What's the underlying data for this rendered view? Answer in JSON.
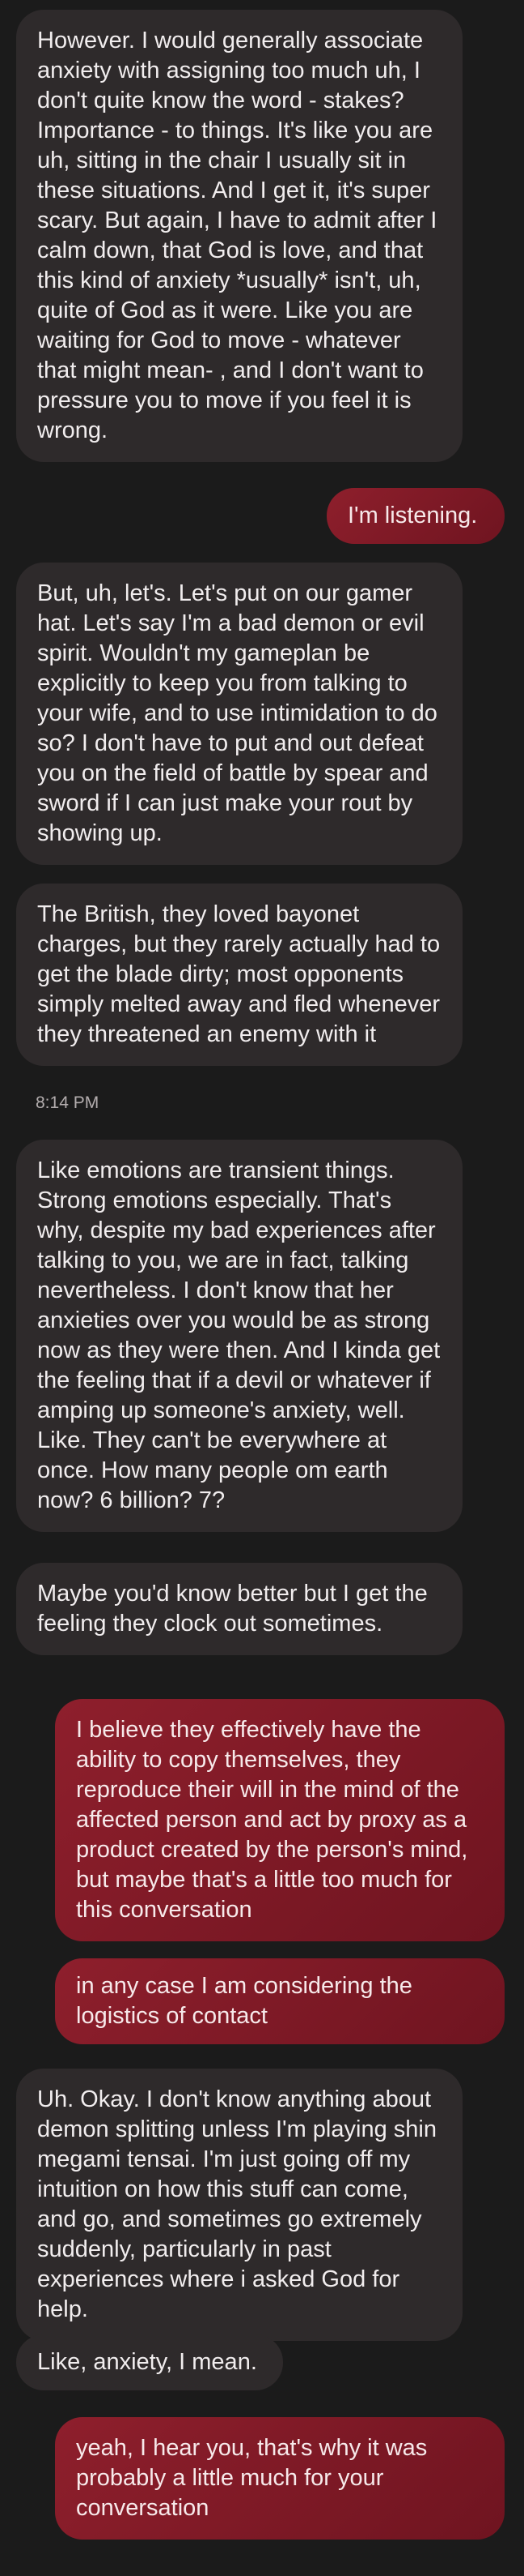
{
  "messages": [
    {
      "direction": "incoming",
      "text": "However. I would generally associate anxiety with assigning too much uh, I don't quite know the word - stakes? Importance - to things. It's like you are uh, sitting in the chair I usually sit in these situations. And I get it, it's super scary. But again, I have to admit after I calm down, that God is love, and that this kind of anxiety *usually* isn't, uh, quite of God as it were. Like you are waiting for God to move - whatever that might mean- , and I don't want to pressure you to move if you feel it is wrong."
    },
    {
      "direction": "outgoing",
      "text": "I'm listening."
    },
    {
      "direction": "incoming",
      "text": "But, uh, let's. Let's put on our gamer hat. Let's say I'm a bad demon or evil spirit. Wouldn't my gameplan be explicitly to keep you from talking to your wife, and to use intimidation to do so? I don't have to put and out defeat you on the field of battle by spear and sword if I can just make your rout by showing up."
    },
    {
      "direction": "incoming",
      "text": "The British, they loved bayonet charges, but they rarely actually had to get the blade dirty; most opponents simply melted away and fled whenever they threatened an enemy with it"
    },
    {
      "direction": "incoming",
      "text": "Like emotions are transient things. Strong emotions especially. That's why, despite my bad experiences after talking to you, we are in fact, talking nevertheless. I don't know that her anxieties over you would be as strong now as they were then. And I kinda get the feeling that if a devil or whatever if amping up someone's anxiety, well. Like. They can't be everywhere at once. How many people om earth now? 6 billion? 7?"
    },
    {
      "direction": "incoming",
      "text": "Maybe you'd know better but I get the feeling they clock out sometimes."
    },
    {
      "direction": "outgoing",
      "text": "I believe they effectively have the ability to copy themselves, they reproduce their will in the mind of the affected person and act by proxy as a product created by the person's mind, but maybe that's a little too much for this conversation"
    },
    {
      "direction": "outgoing",
      "text": "in any case I am considering the logistics of contact"
    },
    {
      "direction": "incoming",
      "text": "Uh. Okay. I don't know anything about demon splitting unless I'm playing shin megami tensai. I'm just going off my intuition on how this stuff can come, and go, and sometimes go extremely suddenly, particularly in past experiences where i asked God for help."
    },
    {
      "direction": "incoming",
      "text": "Like, anxiety, I mean."
    },
    {
      "direction": "outgoing",
      "text": "yeah, I hear you, that's why it was probably a little much for your conversation"
    }
  ],
  "timestamp": "8:14 PM",
  "colors": {
    "background": "#1b1b1b",
    "incoming_bubble": "#2e2a2b",
    "outgoing_bubble": "#8e1f2c",
    "incoming_text": "#f1edee",
    "outgoing_text": "#f7e9ea"
  }
}
